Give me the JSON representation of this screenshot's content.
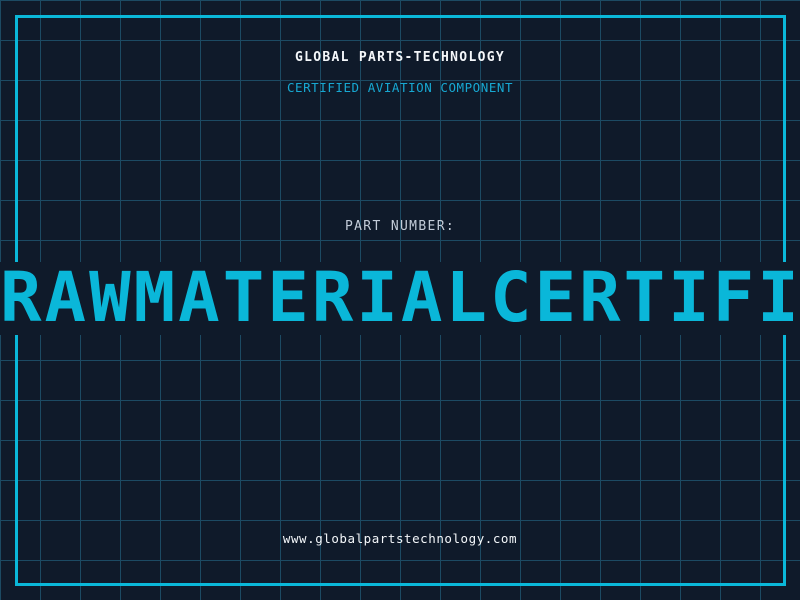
{
  "header": {
    "title": "GLOBAL PARTS-TECHNOLOGY",
    "subtitle": "CERTIFIED AVIATION COMPONENT"
  },
  "part": {
    "label": "PART NUMBER:",
    "value": "RAWMATERIALCERTIFI"
  },
  "footer": {
    "website": "www.globalpartstechnology.com"
  },
  "colors": {
    "background": "#0f1a2a",
    "grid_line": "#1c4a63",
    "accent": "#0ab7d9",
    "subtitle_text": "#17a8d2",
    "title_text": "#f4f7fa",
    "label_text": "#c3ccd8"
  }
}
